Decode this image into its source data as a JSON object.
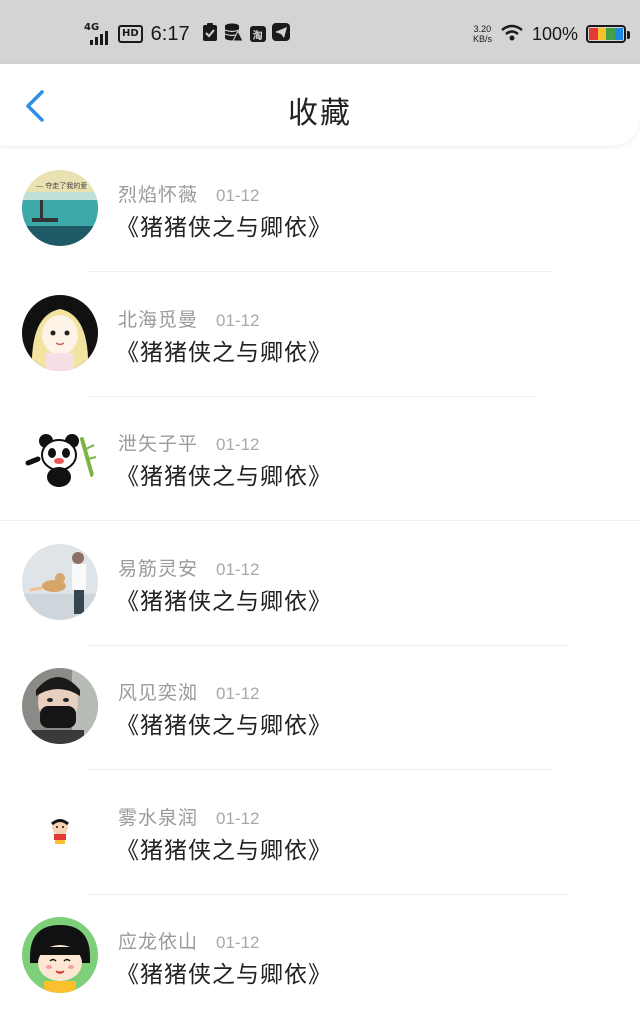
{
  "status_bar": {
    "network": "4G",
    "hd": "HD",
    "time": "6:17",
    "speed_value": "3.20",
    "speed_unit": "KB/s",
    "battery": "100%",
    "icons": [
      "check-clipboard-icon",
      "database-icon",
      "taobao-icon",
      "telegram-icon",
      "wifi-icon",
      "battery-icon"
    ],
    "battery_colors": [
      "#e53935",
      "#fbc02d",
      "#43a047",
      "#1e88e5"
    ]
  },
  "header": {
    "title": "收藏",
    "back_icon": "chevron-left-icon",
    "accent": "#2f8fe6"
  },
  "favorites": [
    {
      "user": "烈焰怀薇",
      "date": "01-12",
      "book": "《猪猪侠之与卿依》",
      "avatar": "seaside-pier-avatar"
    },
    {
      "user": "北海觅曼",
      "date": "01-12",
      "book": "《猪猪侠之与卿依》",
      "avatar": "anime-girl-avatar"
    },
    {
      "user": "泄矢子平",
      "date": "01-12",
      "book": "《猪猪侠之与卿依》",
      "avatar": "panda-avatar"
    },
    {
      "user": "易筋灵安",
      "date": "01-12",
      "book": "《猪猪侠之与卿依》",
      "avatar": "father-child-avatar"
    },
    {
      "user": "风见奕洳",
      "date": "01-12",
      "book": "《猪猪侠之与卿依》",
      "avatar": "masked-person-avatar"
    },
    {
      "user": "雾水泉润",
      "date": "01-12",
      "book": "《猪猪侠之与卿依》",
      "avatar": "crayon-shin-chan-avatar"
    },
    {
      "user": "应龙依山",
      "date": "01-12",
      "book": "《猪猪侠之与卿依》",
      "avatar": "chibi-maruko-avatar"
    }
  ]
}
